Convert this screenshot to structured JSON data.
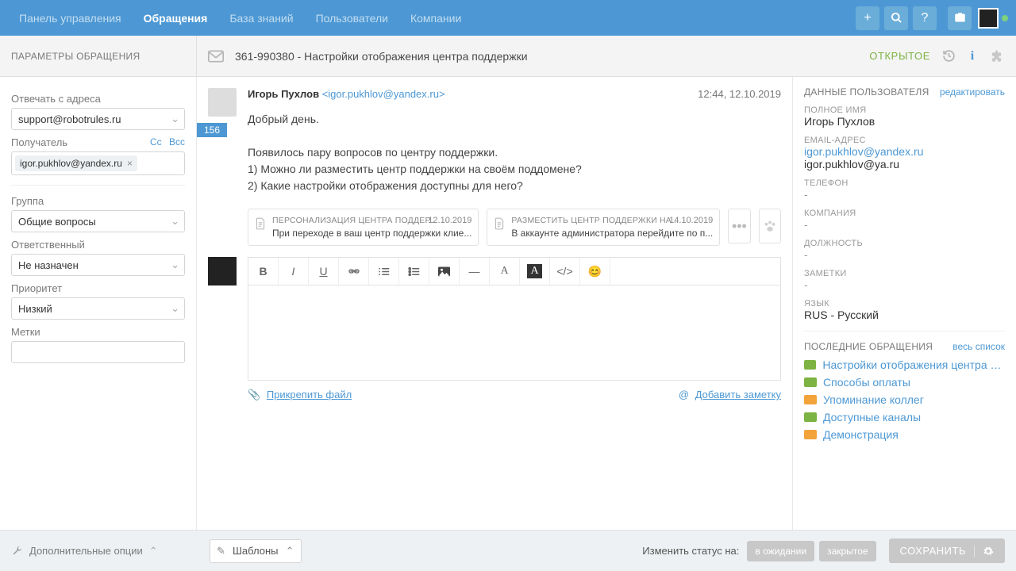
{
  "topnav": {
    "items": [
      "Панель управления",
      "Обращения",
      "База знаний",
      "Пользователи",
      "Компании"
    ],
    "activeIndex": 1
  },
  "left": {
    "title": "ПАРАМЕТРЫ ОБРАЩЕНИЯ",
    "replyFromLabel": "Отвечать с адреса",
    "replyFrom": "support@robotrules.ru",
    "recipientLabel": "Получатель",
    "recipientChip": "igor.pukhlov@yandex.ru",
    "cc": "Cc",
    "bcc": "Bcc",
    "groupLabel": "Группа",
    "group": "Общие вопросы",
    "assigneeLabel": "Ответственный",
    "assignee": "Не назначен",
    "priorityLabel": "Приоритет",
    "priority": "Низкий",
    "tagsLabel": "Метки"
  },
  "ticket": {
    "idTitle": "361-990380 - Настройки отображения центра поддержки",
    "statusOpen": "ОТКРЫТОЕ",
    "count": "156",
    "fromName": "Игорь Пухлов",
    "fromEmail": "<igor.pukhlov@yandex.ru>",
    "time": "12:44, 12.10.2019",
    "bodyLine1": "Добрый день.",
    "bodyLine2": "Появилось пару вопросов по центру поддержки.",
    "bodyLine3": "1) Можно ли разместить центр поддержки на своём поддомене?",
    "bodyLine4": "2) Какие настройки отображения доступны для него?"
  },
  "kb": [
    {
      "title": "ПЕРСОНАЛИЗАЦИЯ ЦЕНТРА ПОДДЕР...",
      "date": "12.10.2019",
      "snippet": "При переходе в ваш центр поддержки клие..."
    },
    {
      "title": "РАЗМЕСТИТЬ ЦЕНТР ПОДДЕРЖКИ НА ...",
      "date": "14.10.2019",
      "snippet": "В аккаунте администратора перейдите по п..."
    }
  ],
  "editorActions": {
    "attach": "Прикрепить файл",
    "addNote": "Добавить заметку"
  },
  "user": {
    "header": "ДАННЫЕ ПОЛЬЗОВАТЕЛЯ",
    "editLink": "редактировать",
    "fullNameLabel": "ПОЛНОЕ ИМЯ",
    "fullName": "Игорь Пухлов",
    "emailLabel": "EMAIL-АДРЕС",
    "emails": [
      "igor.pukhlov@yandex.ru",
      "igor.pukhlov@ya.ru"
    ],
    "phoneLabel": "ТЕЛЕФОН",
    "phone": "-",
    "companyLabel": "КОМПАНИЯ",
    "company": "-",
    "positionLabel": "ДОЛЖНОСТЬ",
    "position": "-",
    "notesLabel": "ЗАМЕТКИ",
    "notes": "-",
    "langLabel": "ЯЗЫК",
    "lang": "RUS - Русский",
    "recentHeader": "ПОСЛЕДНИЕ ОБРАЩЕНИЯ",
    "allLink": "весь список",
    "recent": [
      {
        "color": "g",
        "title": "Настройки отображения центра по..."
      },
      {
        "color": "g",
        "title": "Способы оплаты"
      },
      {
        "color": "o",
        "title": "Упоминание коллег"
      },
      {
        "color": "g",
        "title": "Доступные каналы"
      },
      {
        "color": "o",
        "title": "Демонстрация"
      }
    ]
  },
  "bottom": {
    "extraOptions": "Дополнительные опции",
    "templates": "Шаблоны",
    "changeStatusLabel": "Изменить статус на:",
    "pending": "в ожидании",
    "closed": "закрытое",
    "save": "СОХРАНИТЬ"
  }
}
